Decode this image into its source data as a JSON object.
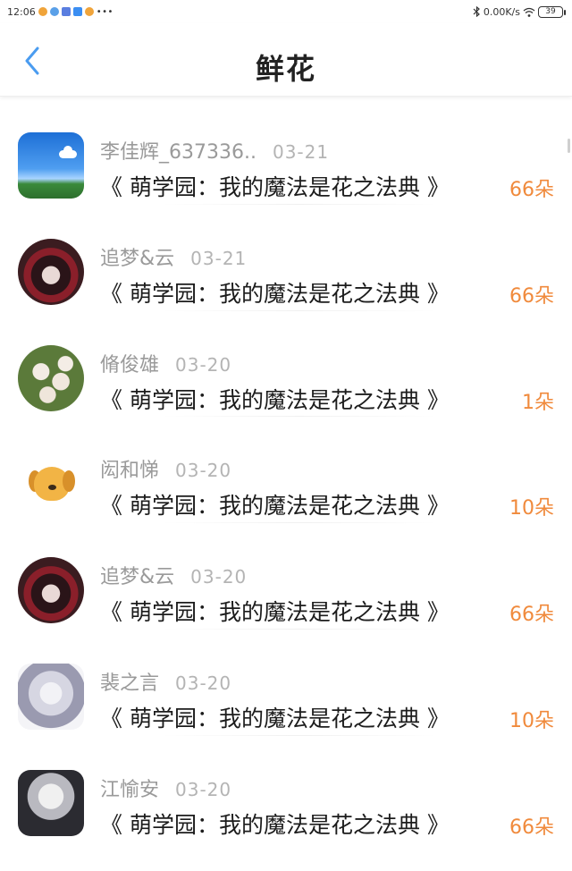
{
  "status_bar": {
    "time": "12:06",
    "more": "•••",
    "network_speed": "0.00K/s",
    "battery": "39"
  },
  "header": {
    "title": "鲜花"
  },
  "records": [
    {
      "name": "李佳辉_637336..",
      "date": "03-21",
      "book": "《 萌学园：我的魔法是花之法典 》",
      "amount": "66朵",
      "avatar": "sky-landscape"
    },
    {
      "name": "追梦&云",
      "date": "03-21",
      "book": "《 萌学园：我的魔法是花之法典 》",
      "amount": "66朵",
      "avatar": "dark-anime-girl"
    },
    {
      "name": "脩俊雄",
      "date": "03-20",
      "book": "《 萌学园：我的魔法是花之法典 》",
      "amount": "1朵",
      "avatar": "white-flowers"
    },
    {
      "name": "闳和悌",
      "date": "03-20",
      "book": "《 萌学园：我的魔法是花之法典 》",
      "amount": "10朵",
      "avatar": "cartoon-dog"
    },
    {
      "name": "追梦&云",
      "date": "03-20",
      "book": "《 萌学园：我的魔法是花之法典 》",
      "amount": "66朵",
      "avatar": "dark-anime-girl"
    },
    {
      "name": "裴之言",
      "date": "03-20",
      "book": "《 萌学园：我的魔法是花之法典 》",
      "amount": "10朵",
      "avatar": "white-hair-anime"
    },
    {
      "name": "江愉安",
      "date": "03-20",
      "book": "《 萌学园：我的魔法是花之法典 》",
      "amount": "66朵",
      "avatar": "pale-anime-girl"
    }
  ],
  "colors": {
    "accent": "#4a9cf0",
    "amount": "#f08a3c",
    "name": "#9a9a9a",
    "date": "#b4b4b4"
  }
}
